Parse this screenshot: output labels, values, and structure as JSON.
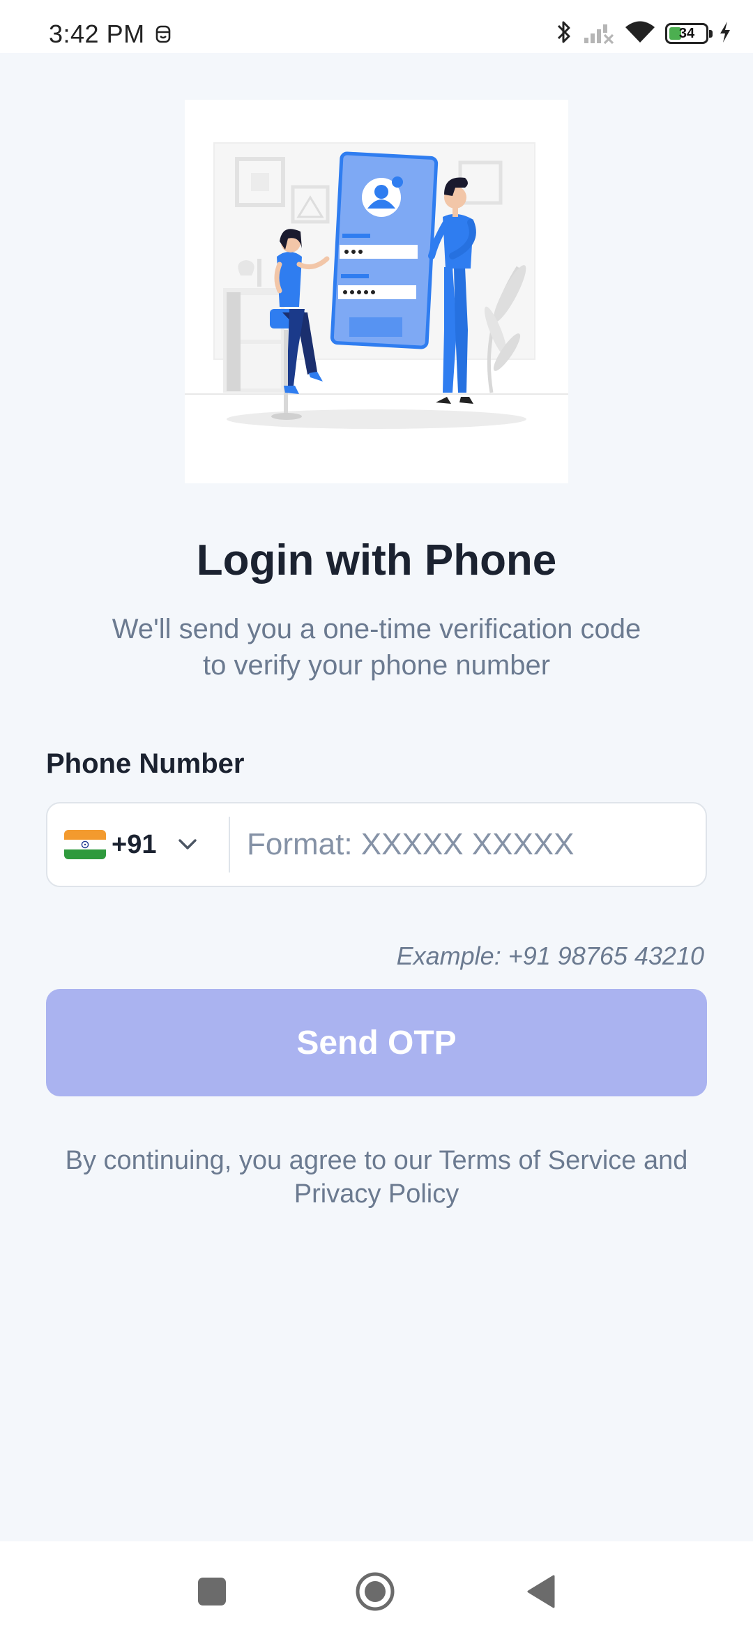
{
  "status_bar": {
    "time": "3:42 PM",
    "battery_level": "34",
    "battery_fraction": 0.34,
    "icons": [
      "notification-icon",
      "bluetooth-icon",
      "signal-off-icon",
      "wifi-icon",
      "battery-icon",
      "charging-icon"
    ]
  },
  "login": {
    "title": "Login with Phone",
    "subtitle": "We'll send you a one-time verification code to verify your phone number",
    "phone_label": "Phone Number",
    "country_code": "+91",
    "phone_value": "",
    "phone_placeholder": "Format: XXXXX XXXXX",
    "example": "Example: +91 98765 43210",
    "send_button_label": "Send OTP",
    "terms": "By continuing, you agree to our Terms of Service and Privacy Policy"
  },
  "navigation": {
    "buttons": [
      "recents-icon",
      "home-icon",
      "back-icon"
    ]
  },
  "colors": {
    "page_background": "#f4f7fb",
    "button_disabled": "#aab3f0",
    "primary_blue": "#2f7df0",
    "text_dark": "#1b2230",
    "text_muted": "#6b7a90"
  }
}
